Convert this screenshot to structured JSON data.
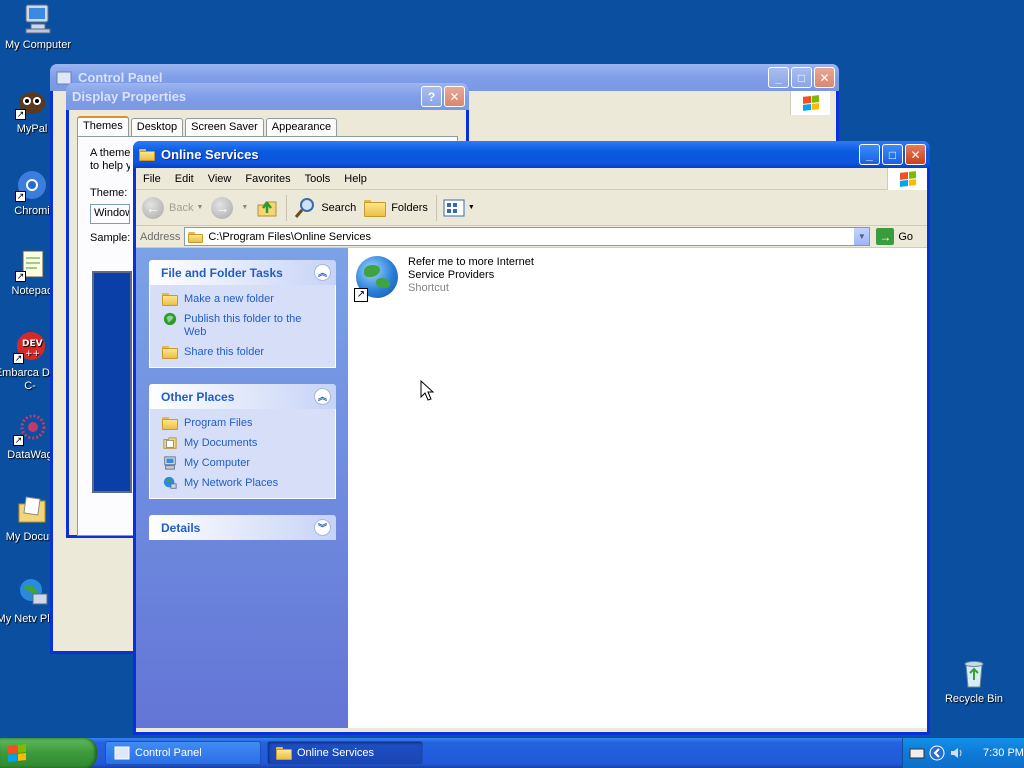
{
  "desktop": {
    "icons": [
      {
        "label": "My Computer"
      },
      {
        "label": "MyPal"
      },
      {
        "label": "Chromi"
      },
      {
        "label": "Notepac"
      },
      {
        "label": "Embarca Dev-C-"
      },
      {
        "label": "DataWag"
      },
      {
        "label": "My Docum"
      },
      {
        "label": "My Netv Place"
      },
      {
        "label": "Recycle Bin"
      }
    ]
  },
  "control_panel": {
    "title": "Control Panel"
  },
  "display_properties": {
    "title": "Display Properties",
    "tabs": [
      "Themes",
      "Desktop",
      "Screen Saver",
      "Appearance"
    ],
    "text": "A theme",
    "text2": "to help y",
    "theme_label": "Theme:",
    "theme_value": "Window",
    "sample_label": "Sample:"
  },
  "online_services": {
    "title": "Online Services",
    "menu": [
      "File",
      "Edit",
      "View",
      "Favorites",
      "Tools",
      "Help"
    ],
    "toolbar": {
      "back": "Back",
      "search": "Search",
      "folders": "Folders"
    },
    "address": {
      "label": "Address",
      "value": "C:\\Program Files\\Online Services",
      "go": "Go"
    },
    "file_tasks": {
      "title": "File and Folder Tasks",
      "items": [
        "Make a new folder",
        "Publish this folder to the Web",
        "Share this folder"
      ]
    },
    "other_places": {
      "title": "Other Places",
      "items": [
        "Program Files",
        "My Documents",
        "My Computer",
        "My Network Places"
      ]
    },
    "details": {
      "title": "Details"
    },
    "file": {
      "name": "Refer me to more Internet Service Providers",
      "type": "Shortcut"
    }
  },
  "taskbar": {
    "buttons": [
      "Control Panel",
      "Online Services"
    ],
    "clock": "7:30 PM"
  },
  "colors": {
    "desktop_bg": "#0a4fa0",
    "title_active": "#0a5ae0",
    "task_link": "#215dc6"
  }
}
